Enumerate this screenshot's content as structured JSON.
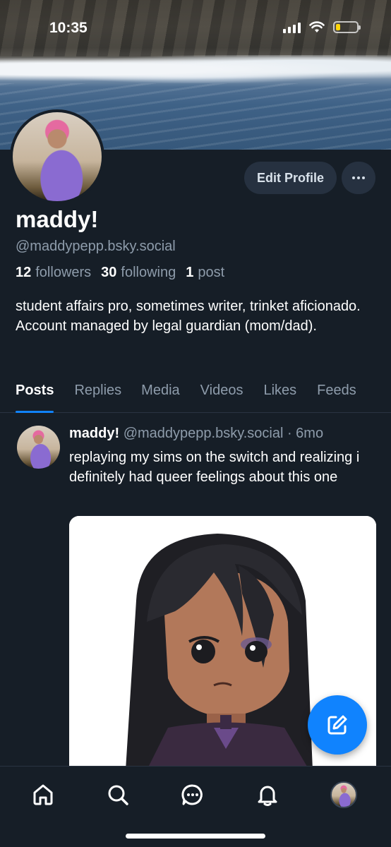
{
  "status_bar": {
    "time": "10:35"
  },
  "profile": {
    "display_name": "maddy!",
    "handle": "@maddypepp.bsky.social",
    "followers_count": "12",
    "followers_label": "followers",
    "following_count": "30",
    "following_label": "following",
    "posts_count": "1",
    "posts_label": "post",
    "bio": "student affairs pro, sometimes writer, trinket aficionado. Account managed by legal guardian (mom/dad).",
    "edit_label": "Edit Profile"
  },
  "tabs": [
    {
      "label": "Posts",
      "active": true
    },
    {
      "label": "Replies"
    },
    {
      "label": "Media"
    },
    {
      "label": "Videos"
    },
    {
      "label": "Likes"
    },
    {
      "label": "Feeds"
    }
  ],
  "post": {
    "author": "maddy!",
    "handle": "@maddypepp.bsky.social",
    "time": "· 6mo",
    "text": "replaying my sims on the switch and realizing i definitely had queer feelings about this one"
  },
  "nav": {
    "items": [
      "home-icon",
      "search-icon",
      "chat-icon",
      "bell-icon",
      "avatar"
    ]
  },
  "colors": {
    "accent": "#1083fe",
    "background": "#161e27",
    "muted": "#8e9cab"
  }
}
